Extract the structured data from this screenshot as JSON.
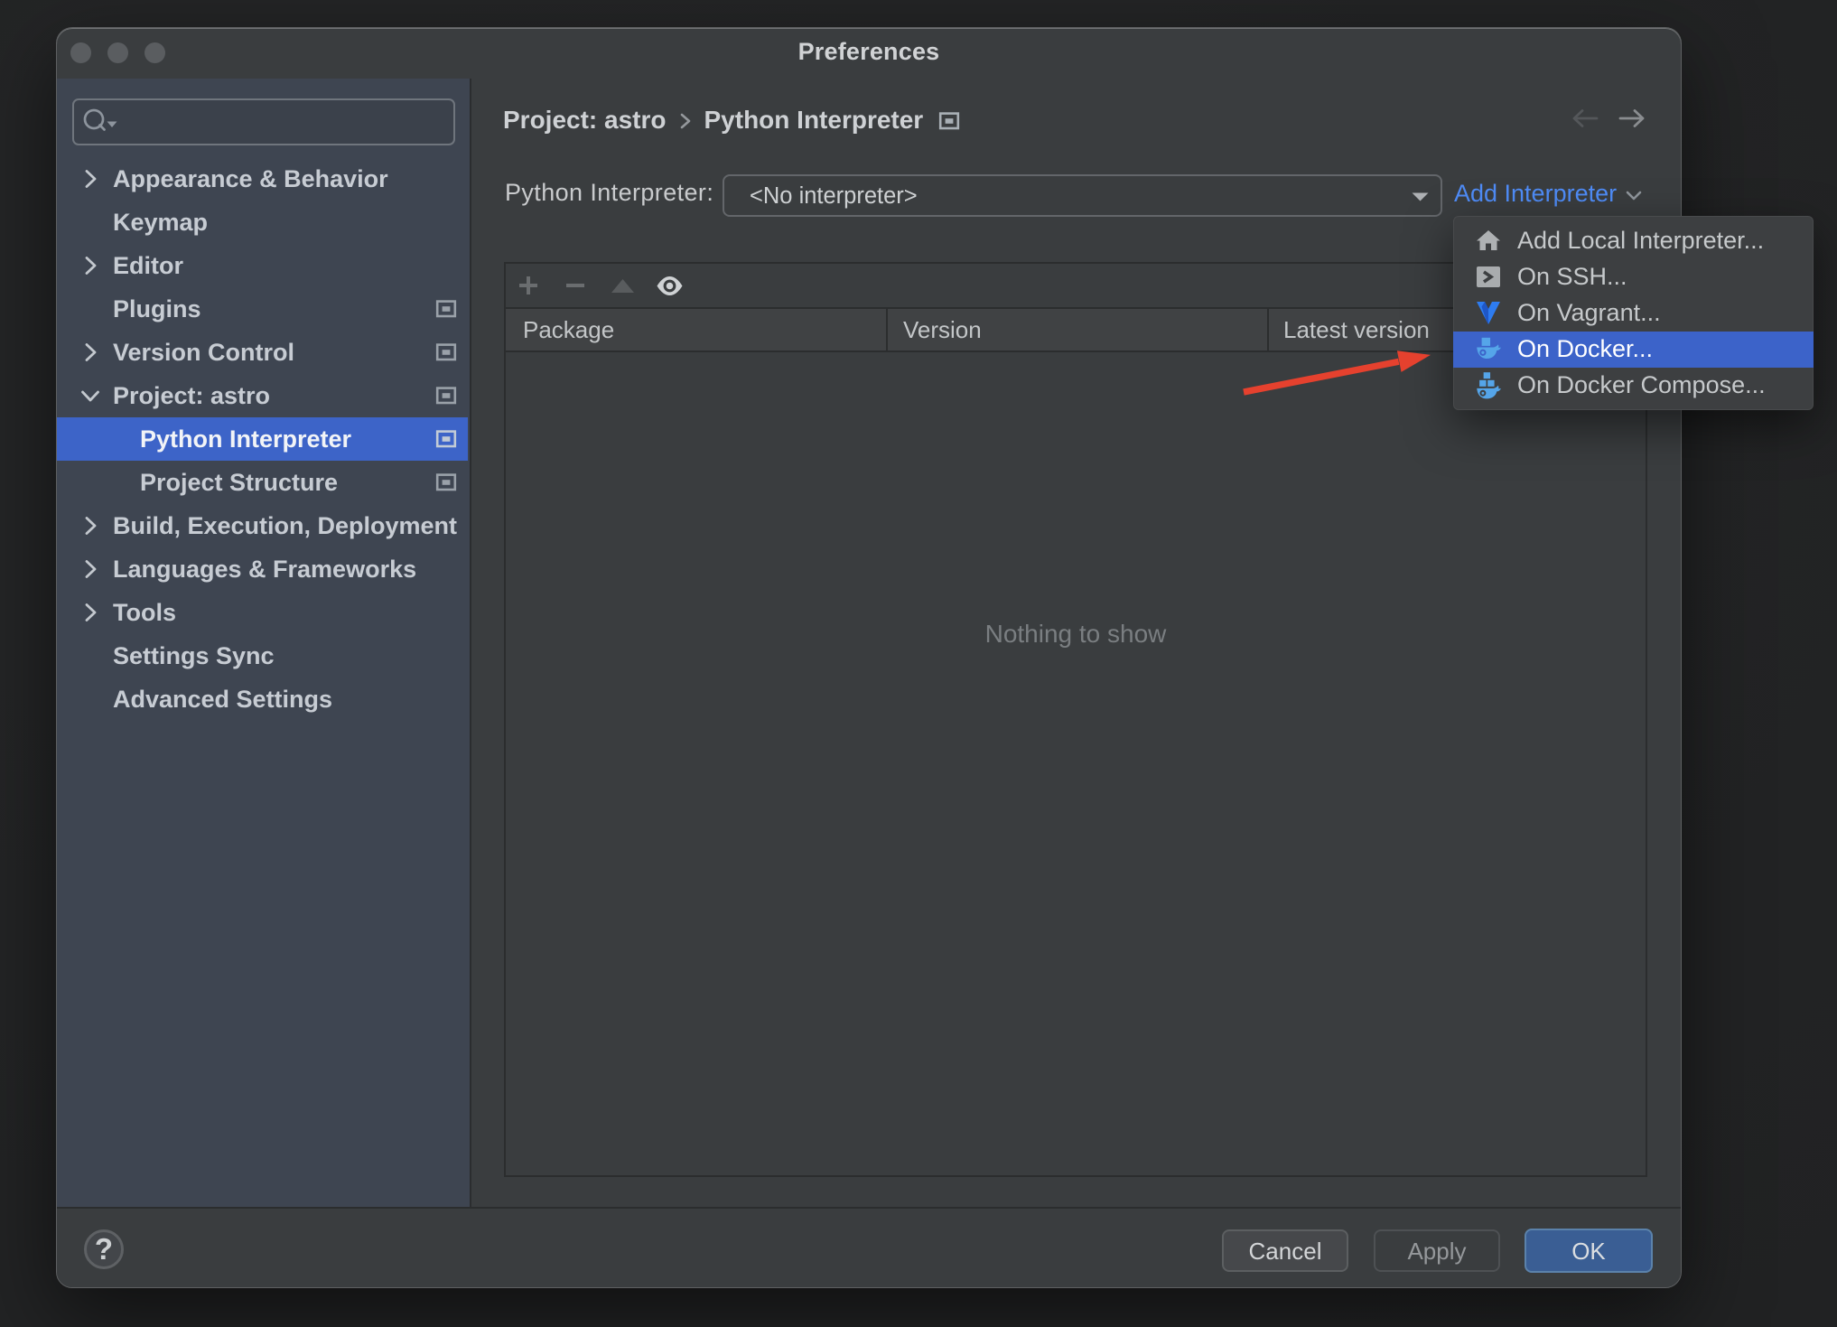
{
  "window": {
    "title": "Preferences"
  },
  "sidebar": {
    "search_placeholder": "",
    "items": [
      {
        "label": "Appearance & Behavior",
        "chevron": "right",
        "has_icon": false,
        "selected": false,
        "child": false
      },
      {
        "label": "Keymap",
        "chevron": null,
        "has_icon": false,
        "selected": false,
        "child": false
      },
      {
        "label": "Editor",
        "chevron": "right",
        "has_icon": false,
        "selected": false,
        "child": false
      },
      {
        "label": "Plugins",
        "chevron": null,
        "has_icon": true,
        "selected": false,
        "child": false
      },
      {
        "label": "Version Control",
        "chevron": "right",
        "has_icon": true,
        "selected": false,
        "child": false
      },
      {
        "label": "Project: astro",
        "chevron": "down",
        "has_icon": true,
        "selected": false,
        "child": false
      },
      {
        "label": "Python Interpreter",
        "chevron": null,
        "has_icon": true,
        "selected": true,
        "child": true
      },
      {
        "label": "Project Structure",
        "chevron": null,
        "has_icon": true,
        "selected": false,
        "child": true
      },
      {
        "label": "Build, Execution, Deployment",
        "chevron": "right",
        "has_icon": false,
        "selected": false,
        "child": false
      },
      {
        "label": "Languages & Frameworks",
        "chevron": "right",
        "has_icon": false,
        "selected": false,
        "child": false
      },
      {
        "label": "Tools",
        "chevron": "right",
        "has_icon": false,
        "selected": false,
        "child": false
      },
      {
        "label": "Settings Sync",
        "chevron": null,
        "has_icon": false,
        "selected": false,
        "child": false
      },
      {
        "label": "Advanced Settings",
        "chevron": null,
        "has_icon": false,
        "selected": false,
        "child": false
      }
    ]
  },
  "breadcrumb": {
    "crumbs": [
      {
        "label": "Project: astro"
      },
      {
        "label": "Python Interpreter"
      }
    ]
  },
  "interpreter": {
    "label": "Python Interpreter:",
    "value": "<No interpreter>",
    "add_button": "Add Interpreter"
  },
  "packages": {
    "columns": [
      "Package",
      "Version",
      "Latest version"
    ],
    "toolbar_icons": [
      "add",
      "remove",
      "move-up",
      "show"
    ],
    "empty_text": "Nothing to show"
  },
  "menu": {
    "items": [
      {
        "label": "Add Local Interpreter...",
        "icon": "home",
        "highlighted": false
      },
      {
        "label": "On SSH...",
        "icon": "ssh-terminal",
        "highlighted": false
      },
      {
        "label": "On Vagrant...",
        "icon": "vagrant",
        "highlighted": false
      },
      {
        "label": "On Docker...",
        "icon": "docker",
        "highlighted": true
      },
      {
        "label": "On Docker Compose...",
        "icon": "docker-compose",
        "highlighted": false
      }
    ]
  },
  "footer": {
    "help": "?",
    "cancel": "Cancel",
    "apply": "Apply",
    "ok": "OK"
  },
  "colors": {
    "selection_blue": "#3D64C8",
    "link_blue": "#4F8CF7",
    "ok_button_blue": "#3A5E94",
    "annotation_red": "#E5412E",
    "sidebar_bg": "#3E4551",
    "window_bg": "#3A3D3F",
    "popup_bg": "#3D3F41"
  }
}
